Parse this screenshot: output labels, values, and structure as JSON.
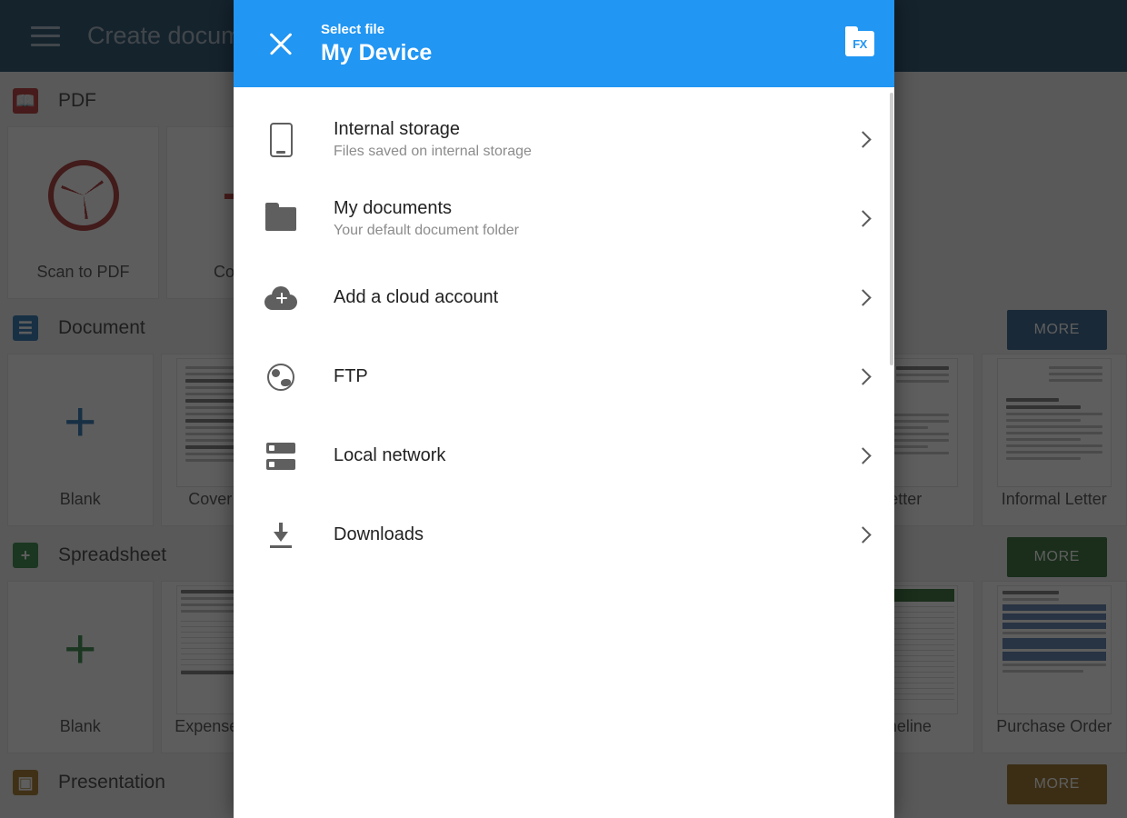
{
  "background": {
    "appbar": {
      "menu_icon": "hamburger-menu-icon",
      "title": "Create document"
    },
    "sections": [
      {
        "icon": "pdf-icon",
        "icon_color": "#b32020",
        "title": "PDF",
        "more_label": "",
        "more_color": "",
        "cards": [
          {
            "label": "Scan to PDF",
            "art": "aperture-icon"
          },
          {
            "label": "Convert",
            "art": "arrow-icon"
          }
        ]
      },
      {
        "icon": "document-icon",
        "icon_color": "#1565a8",
        "title": "Document",
        "more_label": "MORE",
        "more_color": "#1b4f7e",
        "cards": [
          {
            "label": "Blank",
            "art": "plus-icon"
          },
          {
            "label": "Cover Letter",
            "art": "document-thumb"
          },
          {
            "label": "Letter",
            "art": "document-thumb"
          },
          {
            "label": "Informal Letter",
            "art": "document-thumb"
          }
        ]
      },
      {
        "icon": "spreadsheet-icon",
        "icon_color": "#1e7a33",
        "title": "Spreadsheet",
        "more_label": "MORE",
        "more_color": "#1b5e20",
        "cards": [
          {
            "label": "Blank",
            "art": "plus-icon"
          },
          {
            "label": "Expense Report",
            "art": "sheet-thumb"
          },
          {
            "label": "Timeline",
            "art": "sheet-thumb"
          },
          {
            "label": "Purchase Order",
            "art": "order-thumb"
          }
        ]
      },
      {
        "icon": "presentation-icon",
        "icon_color": "#9a6a10",
        "title": "Presentation",
        "more_label": "MORE",
        "more_color": "#8a5e0c",
        "cards": []
      }
    ]
  },
  "dialog": {
    "header": {
      "close_icon": "close-icon",
      "subtitle": "Select file",
      "title": "My Device",
      "app_icon": "fx-folder-icon",
      "app_icon_text": "FX",
      "background_color": "#2196f3"
    },
    "items": [
      {
        "icon": "phone-icon",
        "title": "Internal storage",
        "subtitle": "Files saved on internal storage"
      },
      {
        "icon": "folder-icon",
        "title": "My documents",
        "subtitle": "Your default document folder"
      },
      {
        "icon": "cloud-add-icon",
        "title": "Add a cloud account",
        "subtitle": ""
      },
      {
        "icon": "globe-icon",
        "title": "FTP",
        "subtitle": ""
      },
      {
        "icon": "server-icon",
        "title": "Local network",
        "subtitle": ""
      },
      {
        "icon": "download-icon",
        "title": "Downloads",
        "subtitle": ""
      }
    ]
  }
}
